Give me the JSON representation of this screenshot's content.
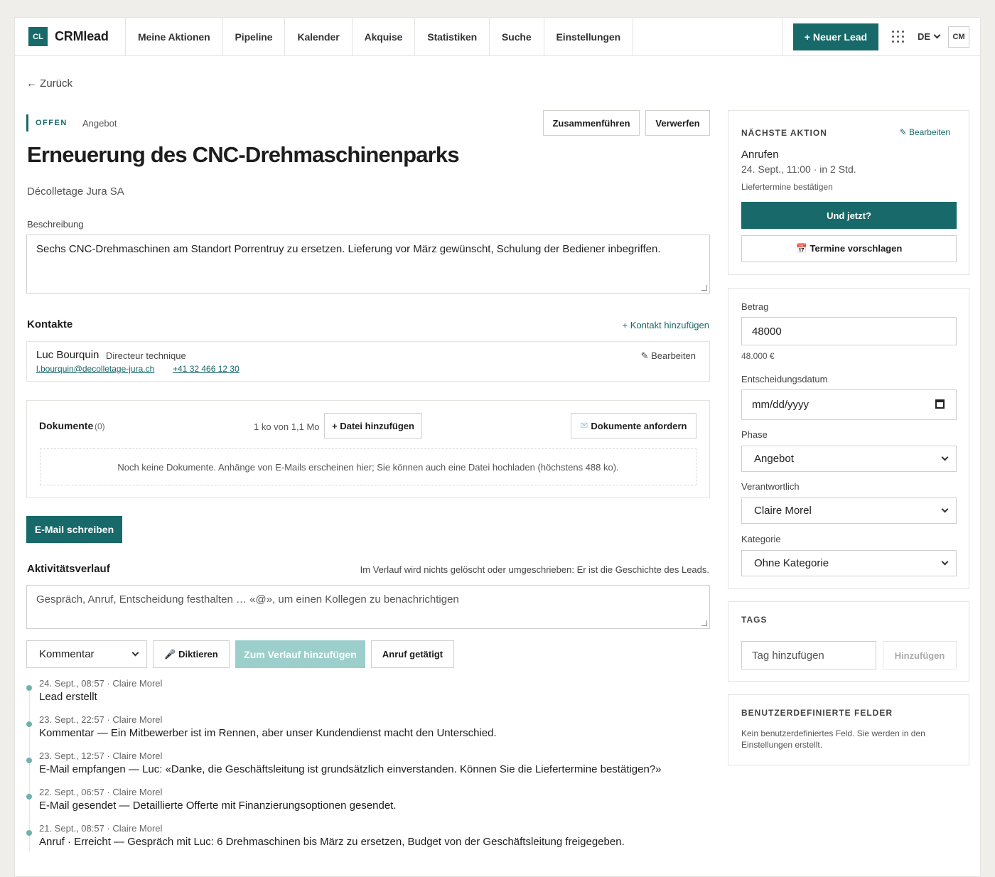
{
  "brand": {
    "badge": "CL",
    "name": "CRMlead"
  },
  "nav": [
    "Meine Aktionen",
    "Pipeline",
    "Kalender",
    "Akquise",
    "Statistiken",
    "Suche",
    "Einstellungen"
  ],
  "topright": {
    "new_lead": "+ Neuer Lead",
    "lang": "DE",
    "avatar": "CM"
  },
  "back": "← Zurück",
  "lead": {
    "status": "OFFEN",
    "phase": "Angebot",
    "title": "Erneuerung des CNC-Drehmaschinenparks",
    "company": "Décolletage Jura SA",
    "merge": "Zusammenführen",
    "discard": "Verwerfen"
  },
  "description": {
    "label": "Beschreibung",
    "value": "Sechs CNC-Drehmaschinen am Standort Porrentruy zu ersetzen. Lieferung vor März gewünscht, Schulung der Bediener inbegriffen."
  },
  "contacts": {
    "title": "Kontakte",
    "add": "+ Kontakt hinzufügen",
    "items": [
      {
        "name": "Luc Bourquin",
        "role": "Directeur technique",
        "email": "l.bourquin@decolletage-jura.ch",
        "phone": "+41 32 466 12 30",
        "edit": "✎ Bearbeiten"
      }
    ]
  },
  "documents": {
    "title": "Dokumente",
    "count": "(0)",
    "quota": "1 ko von 1,1 Mo",
    "add_file": "+ Datei hinzufügen",
    "request": "Dokumente anfordern",
    "empty": "Noch keine Dokumente. Anhänge von E-Mails erscheinen hier; Sie können auch eine Datei hochladen (höchstens 488 ko)."
  },
  "email_button": "E-Mail schreiben",
  "activity": {
    "title": "Aktivitätsverlauf",
    "note": "Im Verlauf wird nichts gelöscht oder umgeschrieben: Er ist die Geschichte des Leads.",
    "placeholder": "Gespräch, Anruf, Entscheidung festhalten … «@», um einen Kollegen zu benachrichtigen",
    "type": "Kommentar",
    "dictate": "🎤 Diktieren",
    "add": "Zum Verlauf hinzufügen",
    "call": "Anruf getätigt",
    "items": [
      {
        "meta": "24. Sept., 08:57 · Claire Morel",
        "text": "Lead erstellt"
      },
      {
        "meta": "23. Sept., 22:57 · Claire Morel",
        "text": "Kommentar — Ein Mitbewerber ist im Rennen, aber unser Kundendienst macht den Unterschied."
      },
      {
        "meta": "23. Sept., 12:57 · Claire Morel",
        "text": "E-Mail empfangen — Luc: «Danke, die Geschäftsleitung ist grundsätzlich einverstanden. Können Sie die Liefertermine bestätigen?»"
      },
      {
        "meta": "22. Sept., 06:57 · Claire Morel",
        "text": "E-Mail gesendet — Detaillierte Offerte mit Finanzierungsoptionen gesendet."
      },
      {
        "meta": "21. Sept., 08:57 · Claire Morel",
        "text": "Anruf · Erreicht — Gespräch mit Luc: 6 Drehmaschinen bis März zu ersetzen, Budget von der Geschäftsleitung freigegeben."
      }
    ]
  },
  "next_action": {
    "title": "NÄCHSTE AKTION",
    "edit": "✎ Bearbeiten",
    "type": "Anrufen",
    "when": "24. Sept., 11:00 · in 2 Std.",
    "note": "Liefertermine bestätigen",
    "now": "Und jetzt?",
    "propose": "📅 Termine vorschlagen"
  },
  "fields": {
    "amount_label": "Betrag",
    "amount": "48000",
    "amount_fmt": "48.000 €",
    "date_label": "Entscheidungsdatum",
    "date_placeholder": "mm/dd/yyyy",
    "phase_label": "Phase",
    "phase": "Angebot",
    "owner_label": "Verantwortlich",
    "owner": "Claire Morel",
    "category_label": "Kategorie",
    "category": "Ohne Kategorie"
  },
  "tags": {
    "title": "TAGS",
    "placeholder": "Tag hinzufügen",
    "add": "Hinzufügen"
  },
  "custom_fields": {
    "title": "BENUTZERDEFINIERTE FELDER",
    "empty": "Kein benutzerdefiniertes Feld. Sie werden in den Einstellungen erstellt."
  },
  "colors": {
    "accent": "#17696a",
    "timeline_dot": "#6fb1ad",
    "disabled_button": "#9ccfcc"
  }
}
